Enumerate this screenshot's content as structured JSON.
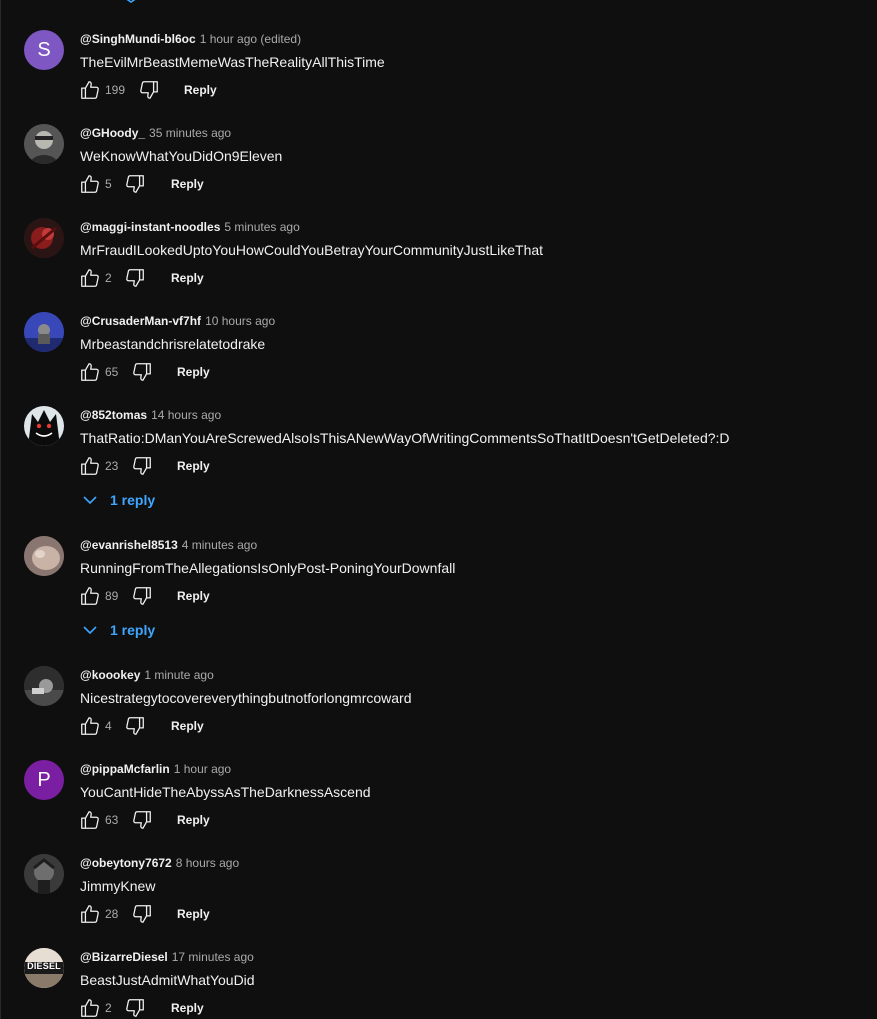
{
  "comments": [
    {
      "author": "@SinghMundi-bl6oc",
      "time": "1 hour ago (edited)",
      "text": "TheEvilMrBeastMemeWasTheRealityAllThisTime",
      "likes": "199",
      "reply_label": "Reply",
      "avatar_letter": "S",
      "avatar_color": "#7e57c2"
    },
    {
      "author": "@GHoody_",
      "time": "35 minutes ago",
      "text": "WeKnowWhatYouDidOn9Eleven",
      "likes": "5",
      "reply_label": "Reply"
    },
    {
      "author": "@maggi-instant-noodles",
      "time": "5 minutes ago",
      "text": "MrFraudILookedUptoYouHowCouldYouBetrayYourCommunityJustLikeThat",
      "likes": "2",
      "reply_label": "Reply"
    },
    {
      "author": "@CrusaderMan-vf7hf",
      "time": "10 hours ago",
      "text": "Mrbeastandchrisrelatetodrake",
      "likes": "65",
      "reply_label": "Reply"
    },
    {
      "author": "@852tomas",
      "time": "14 hours ago",
      "text": "ThatRatio:DManYouAreScrewedAlsoIsThisANewWayOfWritingCommentsSoThatItDoesn'tGetDeleted?:D",
      "likes": "23",
      "reply_label": "Reply",
      "replies_label": "1 reply"
    },
    {
      "author": "@evanrishel8513",
      "time": "4 minutes ago",
      "text": "RunningFromTheAllegationsIsOnlyPost-PoningYourDownfall",
      "likes": "89",
      "reply_label": "Reply",
      "replies_label": "1 reply"
    },
    {
      "author": "@koookey",
      "time": "1 minute ago",
      "text": "Nicestrategytocovereverythingbutnotforlongmrcoward",
      "likes": "4",
      "reply_label": "Reply"
    },
    {
      "author": "@pippaMcfarlin",
      "time": "1 hour ago",
      "text": "YouCantHideTheAbyssAsTheDarknessAscend",
      "likes": "63",
      "reply_label": "Reply",
      "avatar_letter": "P",
      "avatar_color": "#7b1fa2"
    },
    {
      "author": "@obeytony7672",
      "time": "8 hours ago",
      "text": "JimmyKnew",
      "likes": "28",
      "reply_label": "Reply"
    },
    {
      "author": "@BizarreDiesel",
      "time": "17 minutes ago",
      "text": "BeastJustAdmitWhatYouDid",
      "likes": "2",
      "reply_label": "Reply",
      "avatar_text": "DIESEL"
    }
  ],
  "colors": {
    "background": "#0f0f0f",
    "text_primary": "#f1f1f1",
    "text_secondary": "#aaaaaa",
    "link_blue": "#3ea6ff"
  },
  "icons": {
    "like": "thumbs-up-icon",
    "dislike": "thumbs-down-icon",
    "replies_toggle": "chevron-down-icon"
  }
}
